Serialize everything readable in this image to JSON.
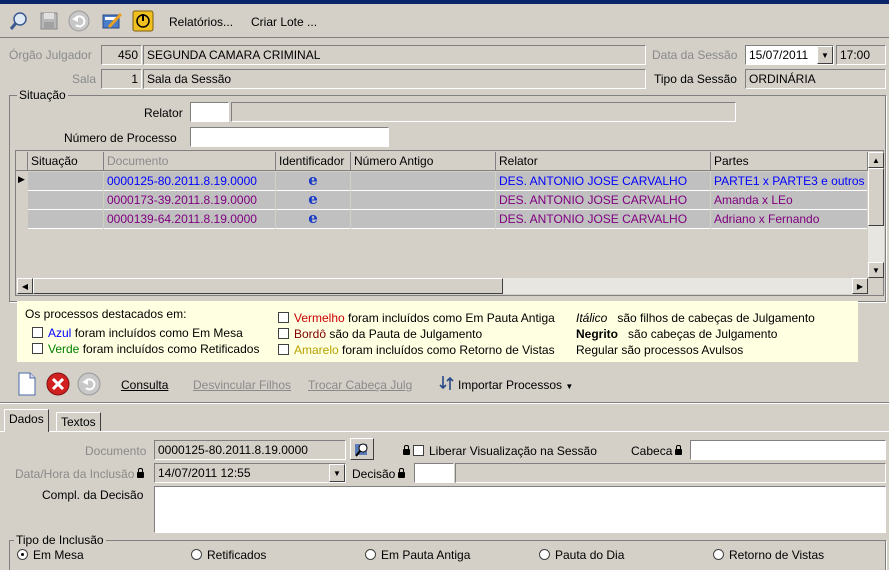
{
  "toolbar": {
    "relatorios": "Relatórios...",
    "criar_lote": "Criar Lote ..."
  },
  "header": {
    "orgao_label": "Órgão Julgador",
    "orgao_code": "450",
    "orgao_name": "SEGUNDA CAMARA CRIMINAL",
    "data_label": "Data da Sessão",
    "data_value": "15/07/2011",
    "hora_value": "17:00",
    "sala_label": "Sala",
    "sala_code": "1",
    "sala_name": "Sala da Sessão",
    "tipo_label": "Tipo da Sessão",
    "tipo_value": "ORDINÁRIA"
  },
  "situacao": {
    "title": "Situação",
    "relator_label": "Relator",
    "relator_code": "",
    "relator_name": "",
    "processo_label": "Número de Processo",
    "processo_value": ""
  },
  "grid": {
    "columns": [
      "Situação",
      "Documento",
      "Identificador",
      "Número Antigo",
      "Relator",
      "Partes"
    ],
    "rows": [
      {
        "situacao": "",
        "documento": "0000125-80.2011.8.19.0000",
        "identificador": "e",
        "numero_antigo": "",
        "relator": "DES. ANTONIO JOSE CARVALHO",
        "partes": "PARTE1 x PARTE3 e outros",
        "color": "blue"
      },
      {
        "situacao": "",
        "documento": "0000173-39.2011.8.19.0000",
        "identificador": "e",
        "numero_antigo": "",
        "relator": "DES. ANTONIO JOSE CARVALHO",
        "partes": "Amanda x LEo",
        "color": "purple"
      },
      {
        "situacao": "",
        "documento": "0000139-64.2011.8.19.0000",
        "identificador": "e",
        "numero_antigo": "",
        "relator": "DES. ANTONIO JOSE CARVALHO",
        "partes": "Adriano x Fernando",
        "color": "purple"
      }
    ]
  },
  "legend": {
    "title": "Os processos destacados em:",
    "azul": "Azul",
    "azul_text": "foram incluídos como Em Mesa",
    "verde": "Verde",
    "verde_text": "foram incluídos como Retificados",
    "vermelho": "Vermelho",
    "vermelho_text": "foram incluídos como Em Pauta Antiga",
    "bordo": "Bordô",
    "bordo_text": "são da Pauta de Julgamento",
    "amarelo": "Amarelo",
    "amarelo_text": "foram incluídos como Retorno de Vistas",
    "italico": "Itálico",
    "italico_text": "são filhos de cabeças de Julgamento",
    "negrito": "Negrito",
    "negrito_text": "são cabeças de Julgamento",
    "regular": "Regular são processos Avulsos"
  },
  "actions": {
    "consulta": "Consulta",
    "desvincular": "Desvincular Filhos",
    "trocar": "Trocar Cabeça Julg",
    "importar": "Importar Processos"
  },
  "tabs": {
    "dados": "Dados",
    "textos": "Textos"
  },
  "dados": {
    "documento_label": "Documento",
    "documento_value": "0000125-80.2011.8.19.0000",
    "liberar_label": "Liberar Visualização na Sessão",
    "cabeca_label": "Cabeca",
    "cabeca_value": "",
    "datahora_label": "Data/Hora da Inclusão",
    "datahora_value": "14/07/2011 12:55",
    "decisao_label": "Decisão",
    "decisao_code": "",
    "decisao_text": "",
    "compl_label": "Compl. da Decisão",
    "compl_value": ""
  },
  "tipo_inclusao": {
    "title": "Tipo de Inclusão",
    "options": [
      "Em Mesa",
      "Retificados",
      "Em Pauta Antiga",
      "Pauta do Dia",
      "Retorno de Vistas"
    ],
    "selected": "Em Mesa"
  },
  "colors": {
    "blue": "#0000ff",
    "purple": "#800080",
    "green": "#008000",
    "red": "#cc0000",
    "bordo": "#800000",
    "amarelo": "#b8a000",
    "legend_bg": "#ffffe1"
  }
}
